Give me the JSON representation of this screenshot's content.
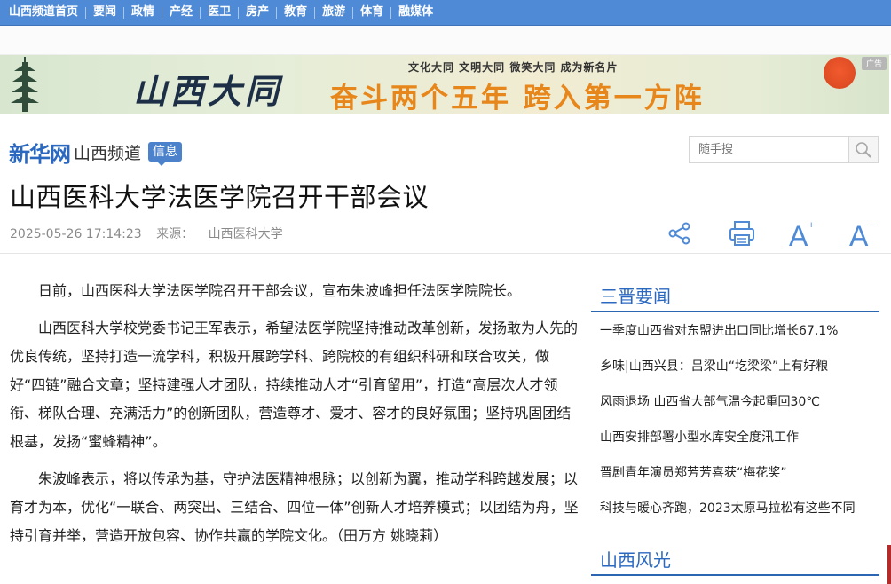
{
  "nav": {
    "items": [
      "山西频道首页",
      "要闻",
      "政情",
      "产经",
      "医卫",
      "房产",
      "教育",
      "旅游",
      "体育",
      "融媒体"
    ]
  },
  "banner": {
    "calligraphy": "山西大同",
    "tagline": "文化大同 文明大同 微笑大同 成为新名片",
    "slogan": "奋斗两个五年 跨入第一方阵",
    "ad_badge": "广告"
  },
  "header": {
    "logo_xinhua": "新华网",
    "logo_channel": "山西频道",
    "logo_badge": "信息",
    "search_placeholder": "随手搜",
    "search_icon": "search-icon"
  },
  "article": {
    "title": "山西医科大学法医学院召开干部会议",
    "datetime": "2025-05-26 17:14:23",
    "source_label": "来源：",
    "source": "山西医科大学",
    "tools": [
      "share-icon",
      "print-icon",
      "font-increase-icon",
      "font-decrease-icon"
    ],
    "paragraphs": [
      "日前，山西医科大学法医学院召开干部会议，宣布朱波峰担任法医学院院长。",
      "山西医科大学校党委书记王军表示，希望法医学院坚持推动改革创新，发扬敢为人先的优良传统，坚持打造一流学科，积极开展跨学科、跨院校的有组织科研和联合攻关，做好“四链”融合文章；坚持建强人才团队，持续推动人才“引育留用”，打造“高层次人才领衔、梯队合理、充满活力”的创新团队，营造尊才、爱才、容才的良好氛围；坚持巩固团结根基，发扬“蜜蜂精神”。",
      "朱波峰表示，将以传承为基，守护法医精神根脉；以创新为翼，推动学科跨越发展；以育才为本，优化“一联合、两突出、三结合、四位一体”创新人才培养模式；以团结为舟，坚持引育并举，营造开放包容、协作共赢的学院文化。（田万方 姚晓莉）"
    ]
  },
  "sidebar": {
    "section1_title": "三晋要闻",
    "news": [
      "一季度山西省对东盟进出口同比增长67.1%",
      "乡味|山西兴县：吕梁山“圪梁梁”上有好粮",
      "风雨退场 山西省大部气温今起重回30℃",
      "山西安排部署小型水库安全度汛工作",
      "晋剧青年演员郑芳芳喜获“梅花奖”",
      "科技与暖心齐跑，2023太原马拉松有这些不同"
    ],
    "section2_title": "山西风光"
  },
  "colors": {
    "nav_bg": "#4f8ad6",
    "brand_blue": "#2b69c0",
    "slogan_orange": "#e7861a"
  }
}
